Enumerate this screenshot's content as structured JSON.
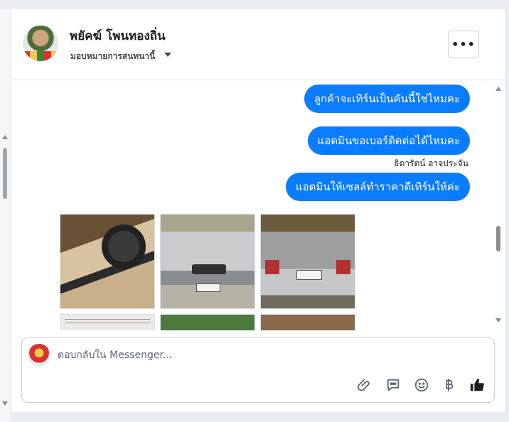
{
  "header": {
    "contact_name": "พยัคฆ์ โพนทองถิ่น",
    "assign_label": "มอบหมายการสนทนานี้",
    "more_label": "•••"
  },
  "messages": [
    {
      "text": "ลูกค้าจะเทิร์นเป็นคันนี้ใช่ไหมคะ"
    },
    {
      "text": "แอดมินขอเบอร์ติดต่อได้ไหมคะ"
    },
    {
      "sender": "ธิดารัตน์ อาจประจัน",
      "text": "แอดมินให้เซลล์ทำราคาดีเทิร์นให้ค่ะ"
    }
  ],
  "photos": [
    {
      "icon": "car-interior-photo"
    },
    {
      "icon": "car-front-photo"
    },
    {
      "icon": "car-rear-photo"
    },
    {
      "icon": "document-photo"
    },
    {
      "icon": "garden-photo"
    },
    {
      "icon": "house-photo"
    }
  ],
  "composer": {
    "placeholder": "ตอบกลับใน Messenger...",
    "tools": [
      "attachment-icon",
      "saved-reply-icon",
      "emoji-icon",
      "payment-icon",
      "like-icon"
    ]
  },
  "colors": {
    "bubble": "#0a7cff",
    "panel_bg": "#ffffff",
    "page_bg": "#e9edf2"
  }
}
